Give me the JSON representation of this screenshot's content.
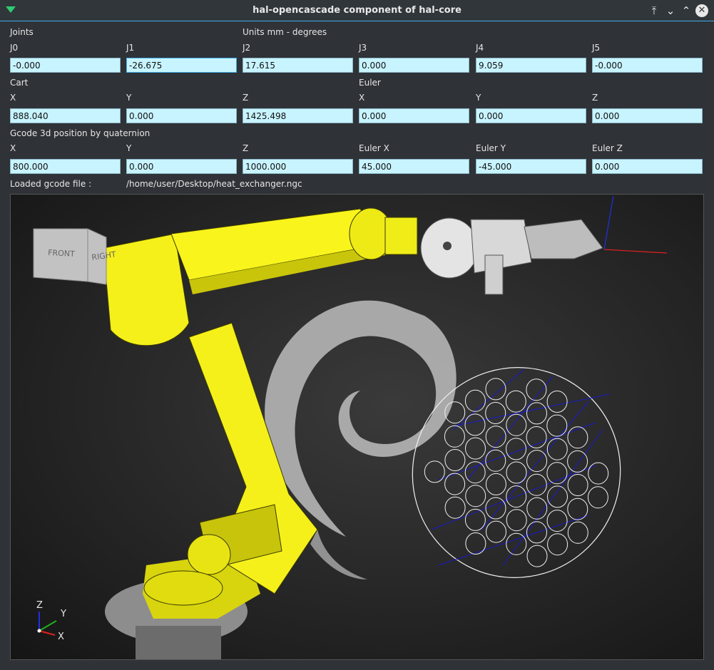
{
  "window": {
    "title": "hal-opencascade component of hal-core",
    "icons": [
      "app-menu-icon",
      "keep-above-icon",
      "minimize-icon",
      "maximize-icon",
      "close-icon"
    ]
  },
  "joints": {
    "section_label": "Joints",
    "units_label": "Units mm - degrees",
    "labels": [
      "J0",
      "J1",
      "J2",
      "J3",
      "J4",
      "J5"
    ],
    "values": [
      "-0.000",
      "-26.675",
      "17.615",
      "0.000",
      "9.059",
      "-0.000"
    ]
  },
  "cart": {
    "section_label": "Cart",
    "euler_label": "Euler",
    "labels": [
      "X",
      "Y",
      "Z",
      "X",
      "Y",
      "Z"
    ],
    "values": [
      "888.040",
      "0.000",
      "1425.498",
      "0.000",
      "0.000",
      "0.000"
    ]
  },
  "gcode": {
    "section_label": "Gcode 3d position by quaternion",
    "labels": [
      "X",
      "Y",
      "Z",
      "Euler X",
      "Euler Y",
      "Euler Z"
    ],
    "values": [
      "800.000",
      "0.000",
      "1000.000",
      "45.000",
      "-45.000",
      "0.000"
    ]
  },
  "loaded_file": {
    "label": "Loaded gcode file :",
    "path": "/home/user/Desktop/heat_exchanger.ngc"
  },
  "viewport": {
    "view_cube": {
      "front": "FRONT",
      "right": "RIGHT"
    },
    "axis_triad": {
      "z": "Z",
      "y": "Y",
      "x": "X"
    },
    "colors": {
      "robot": "#f5f01a",
      "toolpath": "#1a1acc",
      "axis_x": "#e02020",
      "axis_y": "#20b020",
      "axis_z": "#2030e0"
    }
  }
}
